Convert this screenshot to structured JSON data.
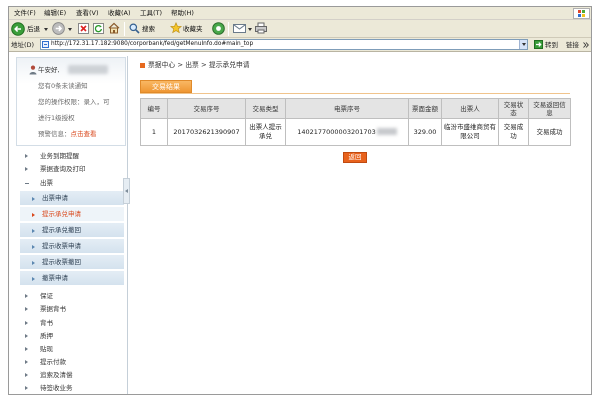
{
  "browser": {
    "menu": [
      "文件(F)",
      "编辑(E)",
      "查看(V)",
      "收藏(A)",
      "工具(T)",
      "帮助(H)"
    ],
    "toolbar": {
      "back_label": "后退",
      "search_label": "搜索",
      "favorites_label": "收藏夹"
    },
    "address_label": "地址(D)",
    "url": "http://172.31.17.182:9080/corporbank/fed/getMenuInfo.do#main_top",
    "go_label": "转到",
    "links_label": "链接"
  },
  "user_panel": {
    "greeting": "午安好,",
    "notice": "您有0条未读通知",
    "permission_line1": "您的操作权限：录入，可",
    "permission_line2": "进行1级授权",
    "alert_label": "预警信息：",
    "alert_link": "点击查看"
  },
  "sidebar_menu": {
    "before": [
      "业务到期提醒",
      "票据查询及打印"
    ],
    "expanded": {
      "label": "出票",
      "children": [
        "出票申请",
        "提示承兑申请",
        "提示承兑撤回",
        "提示收票申请",
        "提示收票撤回",
        "撤票申请"
      ],
      "active_child_index": 1
    },
    "after": [
      "保证",
      "票据背书",
      "背书",
      "质押",
      "贴现",
      "提示付款",
      "追索及清偿",
      "待签收业务"
    ]
  },
  "breadcrumb": "票据中心 > 出票 > 提示承兑申请",
  "result_tab": "交易结果",
  "result_table": {
    "headers": [
      "编号",
      "交易序号",
      "交易类型",
      "电票序号",
      "票面金额",
      "出票人",
      "交易状态",
      "交易返回信息"
    ],
    "rows": [
      {
        "no": "1",
        "txn_seq": "2017032621390907",
        "txn_type": "出票人提示承兑",
        "bill_no": "1402177000003201703",
        "amount": "329.00",
        "drawer": "临汾市盛维商贸有限公司",
        "status": "交易成功",
        "return_info": "交易成功"
      }
    ]
  },
  "back_button": "返回",
  "colors": {
    "chrome": "#ece9d8",
    "accent": "#e8621c",
    "active_menu_text": "#d9481c",
    "submenu_bg": "#dce8f2",
    "table_header_bg": "#e4e4e4",
    "tab_bg": "#ef9633"
  },
  "icons": {
    "back": "back-arrow-icon",
    "forward": "forward-arrow-icon",
    "stop": "stop-icon",
    "refresh": "refresh-icon",
    "home": "home-icon",
    "search": "search-icon",
    "favorites": "favorites-star-icon",
    "media": "media-icon",
    "mail": "mail-icon",
    "print": "print-icon",
    "go": "go-arrow-icon",
    "windows": "windows-logo-icon",
    "user": "user-icon"
  }
}
